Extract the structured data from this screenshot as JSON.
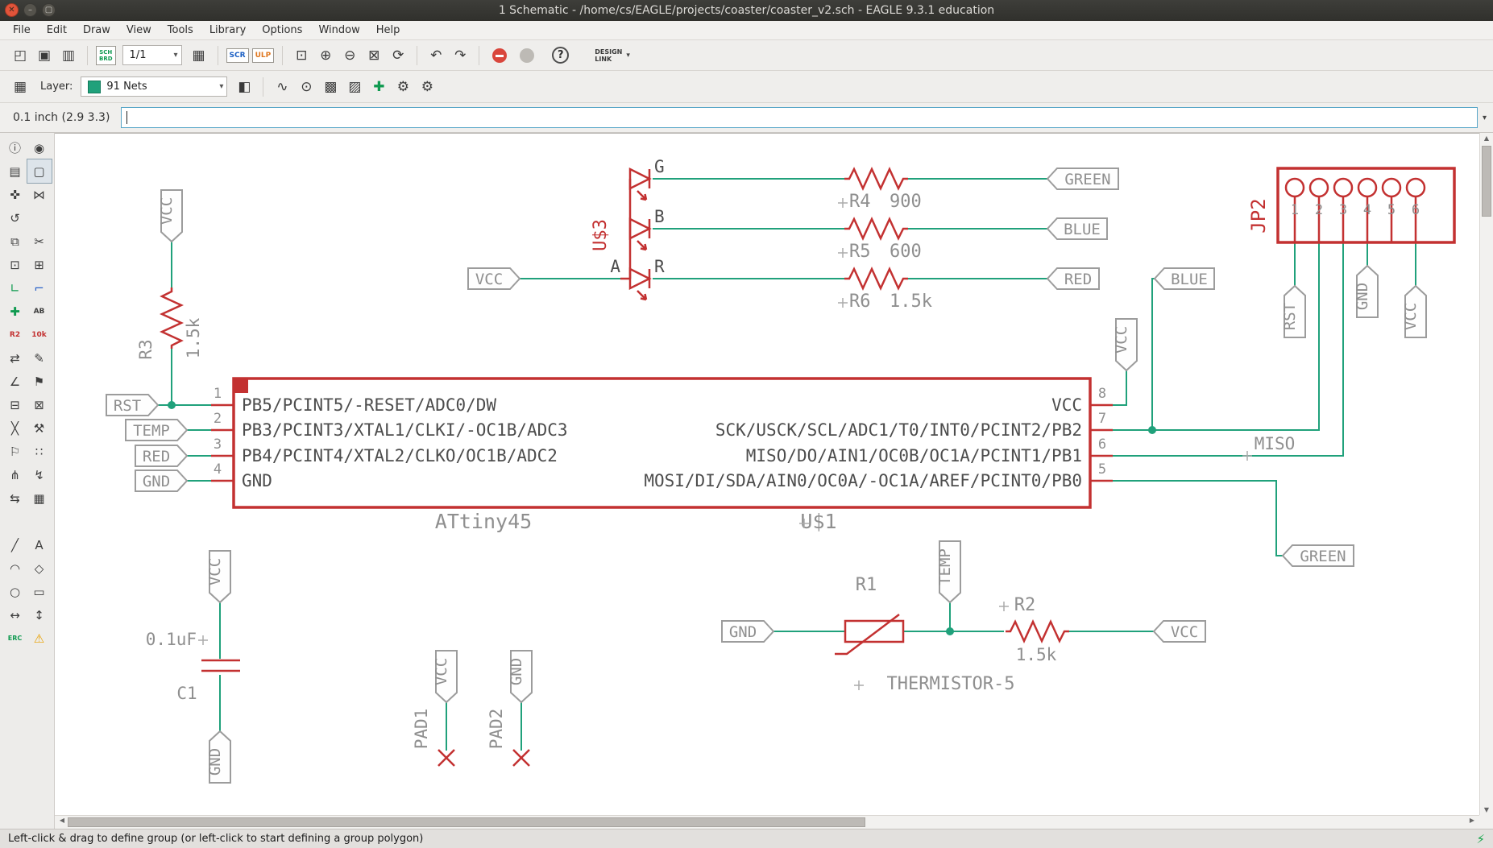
{
  "window": {
    "title": "1 Schematic - /home/cs/EAGLE/projects/coaster/coaster_v2.sch - EAGLE 9.3.1 education",
    "buttons": {
      "close": "✕",
      "minimize": "–",
      "maximize": "▢"
    }
  },
  "menu": {
    "items": [
      "File",
      "Edit",
      "Draw",
      "View",
      "Tools",
      "Library",
      "Options",
      "Window",
      "Help"
    ]
  },
  "toolbar1": {
    "sheet_value": "1/1",
    "board_swap_top": "SCH",
    "board_swap_bottom": "BRD",
    "scr": "SCR",
    "ulp": "ULP",
    "help": "?",
    "design_link_top": "DESIGN",
    "design_link_bottom": "LINK"
  },
  "toolbar2": {
    "layer_label": "Layer:",
    "layer_value": "91 Nets"
  },
  "command": {
    "position": "0.1 inch (2.9 3.3)",
    "value": ""
  },
  "status": {
    "message": "Left-click & drag to define group (or left-click to start defining a group polygon)"
  },
  "icons": {
    "new": "◰",
    "save": "▣",
    "print": "▥",
    "sheet_table": "▦",
    "zoom_fit": "⊡",
    "zoom_in": "⊕",
    "zoom_out": "⊖",
    "zoom_select": "⊠",
    "zoom_redraw": "⟳",
    "undo": "↶",
    "redo": "↷",
    "dropdown": "▾",
    "grid": "▦",
    "layer_stack": "◧",
    "signal": "∿",
    "probe": "⊙",
    "mesh_a": "▩",
    "mesh_b": "▨",
    "add_net": "✚",
    "gear": "⚙",
    "scroll_up": "▲",
    "scroll_down": "▼",
    "scroll_left": "◀",
    "scroll_right": "▶",
    "bolt": "⚡"
  },
  "sidebar": {
    "tools": [
      {
        "name": "info",
        "glyph": "ⓘ"
      },
      {
        "name": "show",
        "glyph": "◉"
      },
      {
        "name": "display",
        "glyph": "▤"
      },
      {
        "name": "group",
        "glyph": "▢"
      },
      {
        "name": "move",
        "glyph": "✜"
      },
      {
        "name": "mirror",
        "glyph": "⋈"
      },
      {
        "name": "rotate",
        "glyph": "↺"
      },
      {
        "name": "spacer",
        "glyph": ""
      },
      {
        "name": "copy",
        "glyph": "⧉"
      },
      {
        "name": "cut",
        "glyph": "✂"
      },
      {
        "name": "paste",
        "glyph": "⊡"
      },
      {
        "name": "duplicate",
        "glyph": "⊞"
      },
      {
        "name": "wire-bend-1",
        "glyph": "∟"
      },
      {
        "name": "wire-bend-2",
        "glyph": "⌐"
      },
      {
        "name": "add-part",
        "glyph": "✚"
      },
      {
        "name": "text-ab",
        "glyph": "AB"
      },
      {
        "name": "name",
        "glyph": "R2"
      },
      {
        "name": "value",
        "glyph": "10k"
      },
      {
        "name": "pinswap",
        "glyph": "⇄"
      },
      {
        "name": "smash",
        "glyph": "✎"
      },
      {
        "name": "miter",
        "glyph": "∠"
      },
      {
        "name": "tag",
        "glyph": "⚑"
      },
      {
        "name": "copy-group",
        "glyph": "⊟"
      },
      {
        "name": "paste-group",
        "glyph": "⊠"
      },
      {
        "name": "delete",
        "glyph": "╳"
      },
      {
        "name": "change",
        "glyph": "⚒"
      },
      {
        "name": "flag",
        "glyph": "⚐"
      },
      {
        "name": "dots",
        "glyph": "∷"
      },
      {
        "name": "split",
        "glyph": "⋔"
      },
      {
        "name": "invoke",
        "glyph": "↯"
      },
      {
        "name": "gateswap",
        "glyph": "⇆"
      },
      {
        "name": "grid-dots",
        "glyph": "▦"
      },
      {
        "name": "spacer",
        "glyph": ""
      },
      {
        "name": "spacer",
        "glyph": ""
      },
      {
        "name": "line",
        "glyph": "╱"
      },
      {
        "name": "text",
        "glyph": "A"
      },
      {
        "name": "arc",
        "glyph": "◠"
      },
      {
        "name": "polygon",
        "glyph": "◇"
      },
      {
        "name": "circle",
        "glyph": "○"
      },
      {
        "name": "rect",
        "glyph": "▭"
      },
      {
        "name": "dimension",
        "glyph": "↔"
      },
      {
        "name": "measure",
        "glyph": "↕"
      },
      {
        "name": "erc",
        "glyph": "ERC"
      },
      {
        "name": "erc-errors",
        "glyph": "⚠"
      }
    ]
  },
  "schematic": {
    "flags": {
      "vcc": "VCC",
      "gnd": "GND",
      "rst": "RST",
      "temp": "TEMP",
      "red": "RED",
      "green": "GREEN",
      "blue": "BLUE",
      "miso": "MISO"
    },
    "u3": {
      "refdes": "U$3",
      "g": "G",
      "b": "B",
      "a": "A",
      "r": "R"
    },
    "r3": {
      "name": "R3",
      "value": "1.5k"
    },
    "r4": {
      "name": "R4",
      "value": "900"
    },
    "r5": {
      "name": "R5",
      "value": "600"
    },
    "r6": {
      "name": "R6",
      "value": "1.5k"
    },
    "ic": {
      "name": "ATtiny45",
      "refdes": "U$1",
      "left_pins": [
        {
          "num": "1",
          "label": "PB5/PCINT5/-RESET/ADC0/DW"
        },
        {
          "num": "2",
          "label": "PB3/PCINT3/XTAL1/CLKI/-OC1B/ADC3"
        },
        {
          "num": "3",
          "label": "PB4/PCINT4/XTAL2/CLKO/OC1B/ADC2"
        },
        {
          "num": "4",
          "label": "GND"
        }
      ],
      "right_pins": [
        {
          "num": "8",
          "label": "VCC"
        },
        {
          "num": "7",
          "label": "SCK/USCK/SCL/ADC1/T0/INT0/PCINT2/PB2"
        },
        {
          "num": "6",
          "label": "MISO/DO/AIN1/OC0B/OC1A/PCINT1/PB1"
        },
        {
          "num": "5",
          "label": "MOSI/DI/SDA/AIN0/OC0A/-OC1A/AREF/PCINT0/PB0"
        }
      ]
    },
    "jp2": {
      "refdes": "JP2",
      "pins": [
        "1",
        "2",
        "3",
        "4",
        "5",
        "6"
      ]
    },
    "c1": {
      "name": "C1",
      "value": "0.1uF"
    },
    "pad1": "PAD1",
    "pad2": "PAD2",
    "therm": {
      "r1": "R1",
      "r2": "R2",
      "r2_value": "1.5k",
      "part": "THERMISTOR-5"
    }
  },
  "colors": {
    "net": "#20A17B",
    "component": "#C33131",
    "label": "#8F8F8F",
    "selection": "#58A6C8"
  }
}
